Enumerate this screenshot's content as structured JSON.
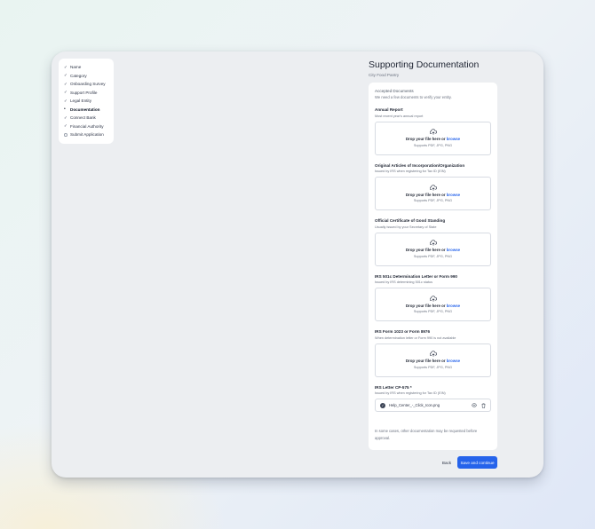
{
  "steps": [
    {
      "label": "Name",
      "status": "done"
    },
    {
      "label": "Category",
      "status": "done"
    },
    {
      "label": "Onboarding Survey",
      "status": "done"
    },
    {
      "label": "Support Profile",
      "status": "done"
    },
    {
      "label": "Legal Entity",
      "status": "done"
    },
    {
      "label": "Documentation",
      "status": "current"
    },
    {
      "label": "Connect Bank",
      "status": "done"
    },
    {
      "label": "Financial Authority",
      "status": "done"
    },
    {
      "label": "Submit Application",
      "status": "pending"
    }
  ],
  "header": {
    "title": "Supporting Documentation",
    "subtitle": "City Food Pantry"
  },
  "card": {
    "accepted_heading": "Accepted Documents",
    "accepted_desc": "We need a few documents to verify your entity.",
    "upload_prompt": "Drop your file here or",
    "browse_label": "browse",
    "supports_text": "Supports PDF, JPG, PNG",
    "documents": [
      {
        "title": "Annual Report",
        "desc": "Most recent year's annual report"
      },
      {
        "title": "Original Articles of Incorporation/Organization",
        "desc": "Issued by IRS when registering for Tax ID (EIN)"
      },
      {
        "title": "Official Certificate of Good Standing",
        "desc": "Usually issued by your Secretary of State"
      },
      {
        "title": "IRS 501c Determination Letter or Form 990",
        "desc": "Issued by IRS determining 501c status"
      },
      {
        "title": "IRS Form 1023 or Form 8976",
        "desc": "When determination letter or Form 990 is not available"
      }
    ],
    "uploaded": {
      "title": "IRS Letter CP-575 *",
      "desc": "Issued by IRS when registering for Tax ID (EIN)",
      "file_name": "Help_Center_-_Click_Icon.png",
      "check_icon": "check-circle-icon",
      "view_icon": "eye-icon",
      "delete_icon": "trash-icon"
    },
    "note": "In some cases, other documentation may be requested before approval."
  },
  "footer": {
    "back_label": "Back",
    "save_label": "Save and continue"
  },
  "colors": {
    "accent": "#2563eb",
    "card_bg": "#ffffff",
    "window_bg": "#eceef1"
  }
}
